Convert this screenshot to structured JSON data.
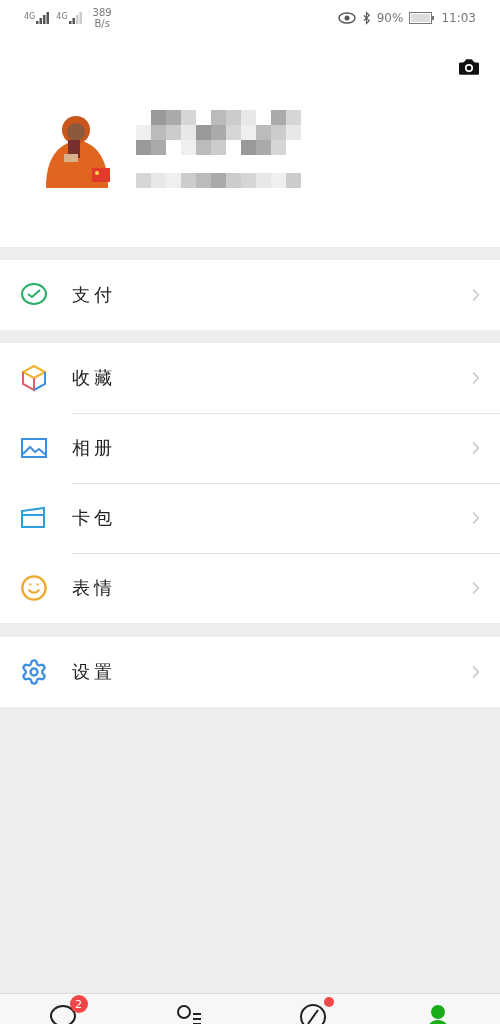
{
  "status_bar": {
    "signal_labels": [
      "4G",
      "4G"
    ],
    "network_speed": "389",
    "speed_unit": "B/s",
    "battery": "90%",
    "time": "11:03"
  },
  "groups": [
    [
      {
        "label": "支付",
        "kind": "pay"
      }
    ],
    [
      {
        "label": "收藏",
        "kind": "favorites"
      },
      {
        "label": "相册",
        "kind": "album"
      },
      {
        "label": "卡包",
        "kind": "cards"
      },
      {
        "label": "表情",
        "kind": "stickers"
      }
    ],
    [
      {
        "label": "设置",
        "kind": "settings"
      }
    ]
  ],
  "tabs": [
    {
      "kind": "chats",
      "badge": "2",
      "dot": false,
      "selected": false
    },
    {
      "kind": "contacts",
      "dot": false,
      "selected": false
    },
    {
      "kind": "discover",
      "dot": true,
      "selected": false
    },
    {
      "kind": "me",
      "dot": false,
      "selected": true
    }
  ]
}
